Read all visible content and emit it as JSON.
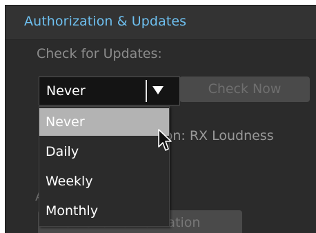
{
  "section": {
    "title": "Authorization & Updates"
  },
  "updates": {
    "label": "Check for Updates:",
    "selected_value": "Never",
    "check_now_label": "Check Now",
    "options": [
      "Never",
      "Daily",
      "Weekly",
      "Monthly"
    ]
  },
  "background": {
    "partial_text": "tion: RX Loudness",
    "partial_letter": "A",
    "remove_button_label": "Remove Authorization"
  },
  "colors": {
    "header_text": "#6ec0f0",
    "selected_option_bg": "#b3b3b3"
  },
  "icons": {
    "select_arrow": "triangle-down",
    "cursor": "mouse-pointer-arrow"
  }
}
